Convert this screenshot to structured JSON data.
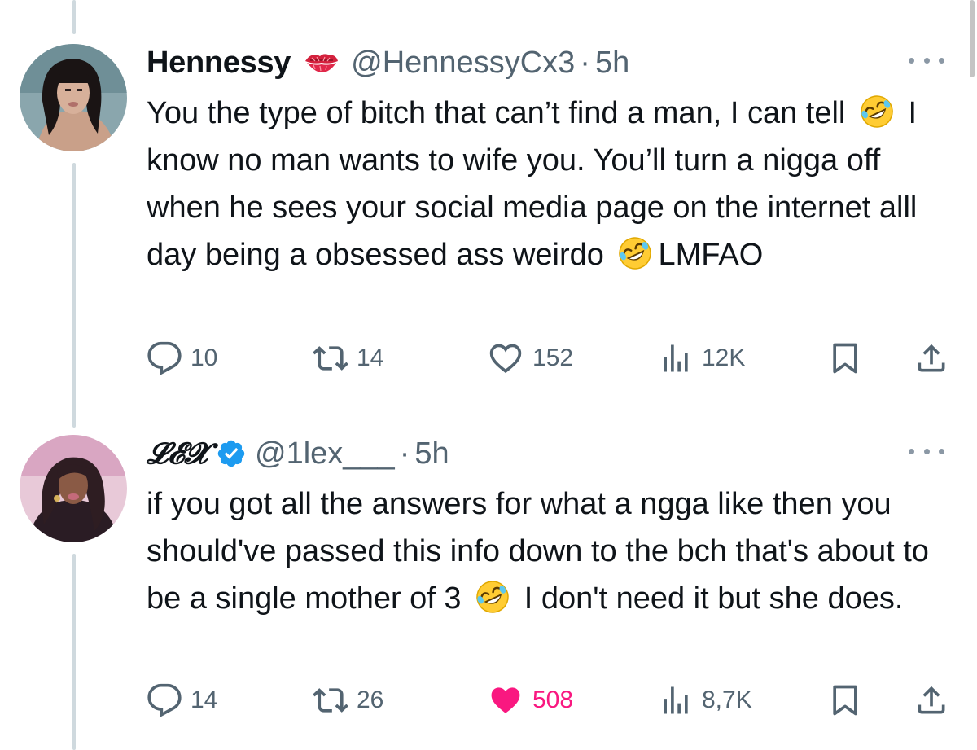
{
  "tweets": [
    {
      "name": "Hennessy",
      "name_emoji": "kiss-mark",
      "handle": "@HennessyCx3",
      "separator": "·",
      "time": "5h",
      "text_parts": [
        "You the type of bitch that can’t find a man, I can tell",
        "I know no man wants to wife you. You’ll turn a nigga off when he sees your social media page on the internet alll day being a obsessed ass weirdo",
        "LMFAO"
      ],
      "stats": {
        "replies": "10",
        "retweets": "14",
        "likes": "152",
        "views": "12K"
      },
      "liked": false
    },
    {
      "name": "𝓛𝓔𝓧",
      "verified": true,
      "handle": "@1lex___",
      "separator": "·",
      "time": "5h",
      "text_parts": [
        "if you got all the answers for what a ngga like then you should've passed this info down to the bch that's about to be a single mother of 3",
        "I don't need it but she does."
      ],
      "stats": {
        "replies": "14",
        "retweets": "26",
        "likes": "508",
        "views": "8,7K"
      },
      "liked": true
    }
  ],
  "colors": {
    "text": "#0f1419",
    "secondary": "#536471",
    "like_active": "#f91880",
    "verified": "#1d9bf0",
    "thread_line": "#cfd9de"
  },
  "icons": [
    "reply-icon",
    "retweet-icon",
    "like-icon",
    "views-icon",
    "bookmark-icon",
    "share-icon",
    "more-icon",
    "verified-icon",
    "rofl-emoji",
    "kiss-mark-emoji"
  ]
}
